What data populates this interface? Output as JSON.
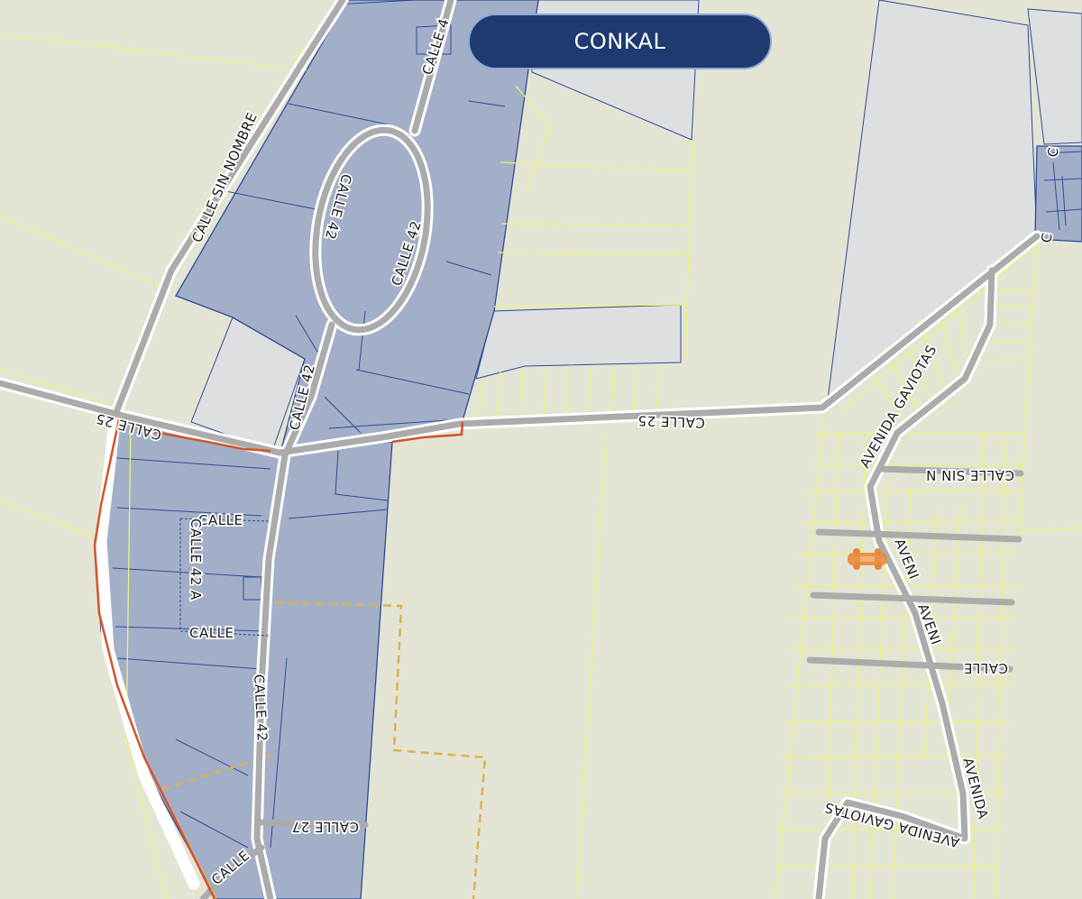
{
  "map_title": "CONKAL",
  "labels": {
    "calle_sin_nombre": "CALLE SIN NOMBRE",
    "calle_4_top": "CALLE 4",
    "calle_42_ring_left": "CALLE 42",
    "calle_42_ring_right": "CALLE 42",
    "calle_42_main": "CALLE 42",
    "calle_42_lower": "CALLE 42",
    "calle_25_west": "CALLE 25",
    "calle_25_east": "CALLE 25",
    "calle_upper": "CALLE",
    "calle_42a": "CALLE 42 A",
    "calle_lower": "CALLE",
    "calle_27": "CALLE 27",
    "calle_bottom": "CALLE",
    "avenida_gaviotas_north": "AVENIDA GAVIOTAS",
    "calle_sin_n": "CALLE SIN N",
    "aveni_1": "AVENI",
    "aveni_2": "AVENI",
    "calle_east": "CALLE",
    "avenida_south": "AVENIDA",
    "avenida_gaviotas_south": "AVENIDA GAVIOTAS",
    "edge_c1": "C",
    "edge_c2": "C"
  },
  "colors": {
    "background": "#e4e4d4",
    "parcel_fill": "#a3afc8",
    "parcel_stroke": "#2b4b95",
    "light_parcel_fill": "#dedfe0",
    "parcel_line": "#ecf27a",
    "road": "#ababab",
    "road_casing": "#ffffff",
    "boundary_red": "#d2542b",
    "dashed_orange": "#e0b050",
    "title_bg": "#1e3a6e",
    "marker": "#e8873a"
  },
  "icons": {
    "marker": "car-marker-icon"
  }
}
